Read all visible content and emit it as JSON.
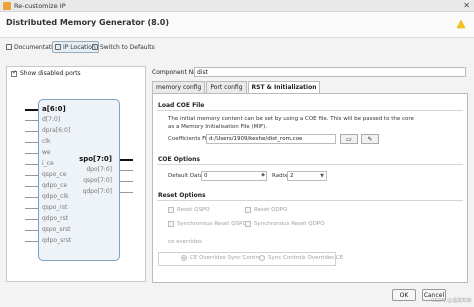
{
  "window": {
    "title": "Re-customize IP",
    "close_glyph": "✕"
  },
  "header": {
    "title": "Distributed Memory Generator (8.0)",
    "logo": "xilinx-logo"
  },
  "toolbar": {
    "doc": "Documentation",
    "ip_location": "IP Location",
    "switch": "Switch to Defaults"
  },
  "left": {
    "show_disabled": "Show disabled ports",
    "show_disabled_checked": true,
    "inputs": [
      "a[6:0]",
      "d[7:0]",
      "dpra[6:0]",
      "clk",
      "we",
      "i_ce",
      "qspo_ce",
      "qdpo_ce",
      "qdpo_clk",
      "qspo_rst",
      "qdpo_rst",
      "qspo_srst",
      "qdpo_srst"
    ],
    "outputs": [
      "spo[7:0]",
      "dpo[7:0]",
      "qspo[7:0]",
      "qdpo[7:0]"
    ]
  },
  "right": {
    "component_label": "Component Name",
    "component_value": "dist",
    "tabs": [
      "memory config",
      "Port config",
      "RST & Initialization"
    ],
    "active_tab": 2,
    "load_coe": {
      "heading": "Load COE File",
      "desc1": "The initial memory content can be set by using a COE file. This will be passed to the core",
      "desc2": "as a Memory Initialisation File (MIF).",
      "coe_label": "Coefficients File",
      "coe_value": "d:/Users/1909/keshe/dist_rom.coe"
    },
    "coe_options": {
      "heading": "COE Options",
      "default_label": "Default Data",
      "default_value": "0",
      "radix_label": "Radix",
      "radix_value": "2"
    },
    "reset_options": {
      "heading": "Reset Options",
      "reset_qspo": "Reset QSPO",
      "reset_qdpo": "Reset QDPO",
      "sync_qspo": "Synchronous Reset QSPO",
      "sync_qdpo": "Synchronous Reset QDPO",
      "ce_overrides": "ce overrides",
      "ce_opt1": "CE Overrides Sync Controls",
      "ce_opt2": "Sync Controls Overrides CE"
    }
  },
  "footer": {
    "ok": "OK",
    "cancel": "Cancel",
    "watermark": "CSDN @温故知新"
  }
}
